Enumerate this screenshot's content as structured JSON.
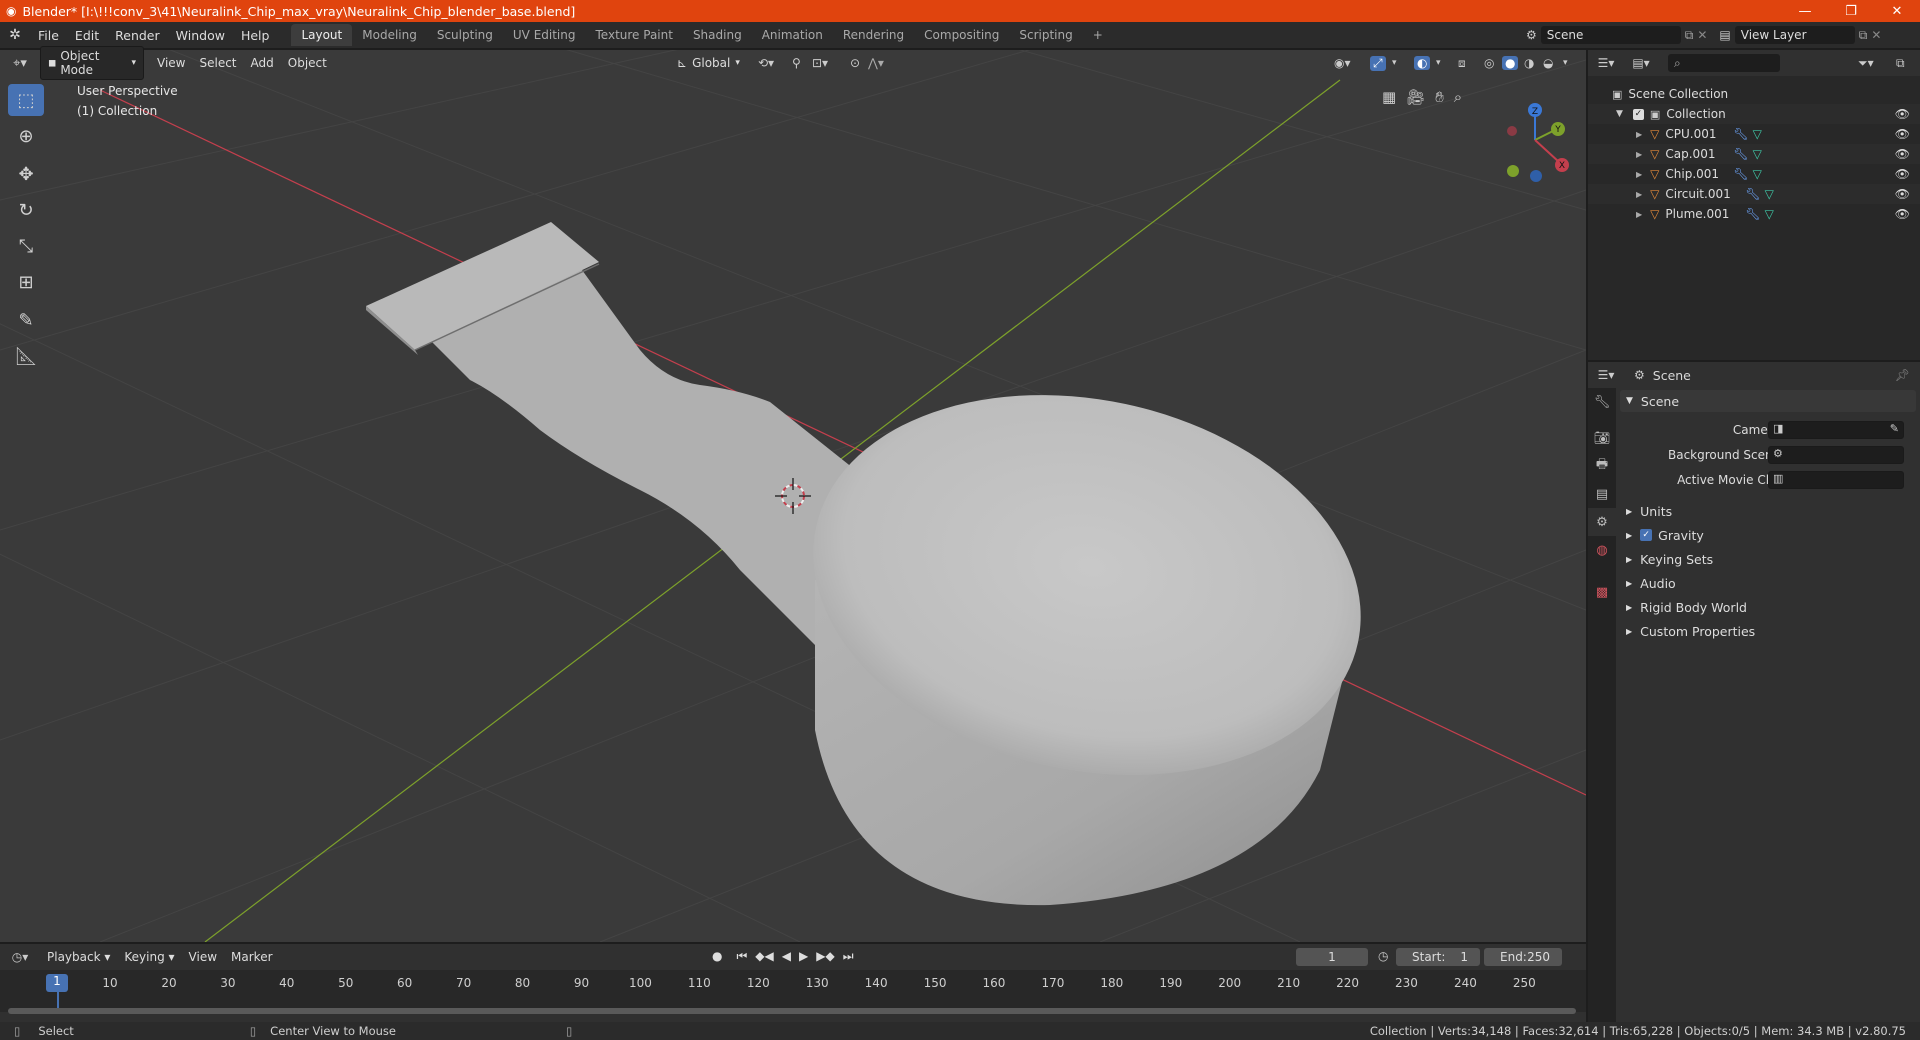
{
  "window": {
    "title": "Blender* [I:\\!!!conv_3\\41\\Neuralink_Chip_max_vray\\Neuralink_Chip_blender_base.blend]",
    "controls": [
      "—",
      "❐",
      "✕"
    ]
  },
  "menu": [
    "File",
    "Edit",
    "Render",
    "Window",
    "Help"
  ],
  "workspaces": [
    "Layout",
    "Modeling",
    "Sculpting",
    "UV Editing",
    "Texture Paint",
    "Shading",
    "Animation",
    "Rendering",
    "Compositing",
    "Scripting"
  ],
  "active_workspace": "Layout",
  "add_tab": "+",
  "scene_selector": "Scene",
  "view_layer_selector": "View Layer",
  "viewport": {
    "mode": "Object Mode",
    "header_menus": [
      "View",
      "Select",
      "Add",
      "Object"
    ],
    "orientation": "Global",
    "info_line1": "User Perspective",
    "info_line2": "(1) Collection",
    "gizmo_axes": {
      "z": "Z",
      "y": "Y",
      "x": "X"
    },
    "tools": [
      "select-box",
      "cursor",
      "move",
      "rotate",
      "scale",
      "transform",
      "annotate",
      "measure"
    ]
  },
  "outliner": {
    "search_placeholder": "",
    "root": "Scene Collection",
    "collection": "Collection",
    "objects": [
      "CPU.001",
      "Cap.001",
      "Chip.001",
      "Circuit.001",
      "Plume.001"
    ]
  },
  "properties": {
    "context": "Scene",
    "panel_title": "Scene",
    "fields": {
      "camera": "Camera",
      "background_scene": "Background Scene",
      "active_movie_clip": "Active Movie Clip"
    },
    "subpanels": [
      "Units",
      "Gravity",
      "Keying Sets",
      "Audio",
      "Rigid Body World",
      "Custom Properties"
    ],
    "gravity_checked": true
  },
  "timeline": {
    "menus": [
      "Playback",
      "Keying",
      "View",
      "Marker"
    ],
    "current_frame": "1",
    "start_label": "Start:",
    "start_value": "1",
    "end_label": "End:",
    "end_value": "250",
    "ticks": [
      "1",
      "10",
      "20",
      "30",
      "40",
      "50",
      "60",
      "70",
      "80",
      "90",
      "100",
      "110",
      "120",
      "130",
      "140",
      "150",
      "160",
      "170",
      "180",
      "190",
      "200",
      "210",
      "220",
      "230",
      "240",
      "250"
    ]
  },
  "statusbar": {
    "select": "Select",
    "center_view": "Center View to Mouse",
    "stats": "Collection | Verts:34,148 | Faces:32,614 | Tris:65,228 | Objects:0/5 | Mem: 34.3 MB | v2.80.75"
  },
  "colors": {
    "title_bar": "#e0440e",
    "accent": "#4772b3",
    "x_axis": "#c43f4d",
    "y_axis": "#7da12b",
    "object_orange": "#e0883a"
  }
}
